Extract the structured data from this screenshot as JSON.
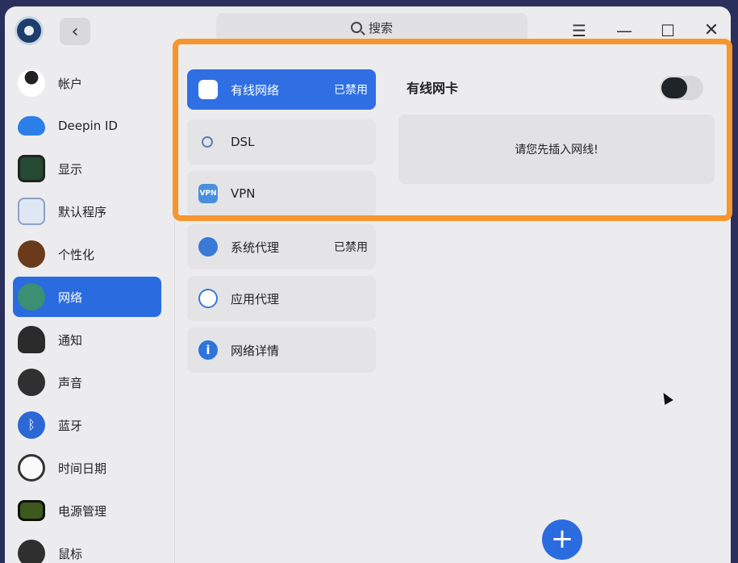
{
  "titlebar": {
    "back_glyph": "‹",
    "search_placeholder": "搜索",
    "menu_glyph": "☰",
    "min_glyph": "—",
    "max_glyph": "☐",
    "close_glyph": "✕"
  },
  "sidebar": {
    "items": [
      {
        "label": "帐户",
        "icon": "account-icon"
      },
      {
        "label": "Deepin ID",
        "icon": "deepin-id-icon"
      },
      {
        "label": "显示",
        "icon": "display-icon"
      },
      {
        "label": "默认程序",
        "icon": "default-apps-icon"
      },
      {
        "label": "个性化",
        "icon": "personalization-icon"
      },
      {
        "label": "网络",
        "icon": "network-icon",
        "active": true
      },
      {
        "label": "通知",
        "icon": "notification-icon"
      },
      {
        "label": "声音",
        "icon": "sound-icon"
      },
      {
        "label": "蓝牙",
        "icon": "bluetooth-icon"
      },
      {
        "label": "时间日期",
        "icon": "clock-icon"
      },
      {
        "label": "电源管理",
        "icon": "power-icon"
      },
      {
        "label": "鼠标",
        "icon": "mouse-icon"
      }
    ]
  },
  "network_menu": {
    "items": [
      {
        "label": "有线网络",
        "status": "已禁用",
        "icon": "wired-network-icon",
        "active": true
      },
      {
        "label": "DSL",
        "status": "",
        "icon": "dsl-icon"
      },
      {
        "label": "VPN",
        "status": "",
        "icon": "vpn-icon",
        "icon_text": "VPN"
      },
      {
        "label": "系统代理",
        "status": "已禁用",
        "icon": "system-proxy-icon"
      },
      {
        "label": "应用代理",
        "status": "",
        "icon": "app-proxy-icon"
      },
      {
        "label": "网络详情",
        "status": "",
        "icon": "info-icon",
        "icon_text": "i"
      }
    ]
  },
  "detail": {
    "title": "有线网卡",
    "toggle_on": false,
    "notice": "请您先插入网线!",
    "add_glyph": "+"
  },
  "colors": {
    "accent": "#2b6be0",
    "highlight": "#f7952e"
  }
}
